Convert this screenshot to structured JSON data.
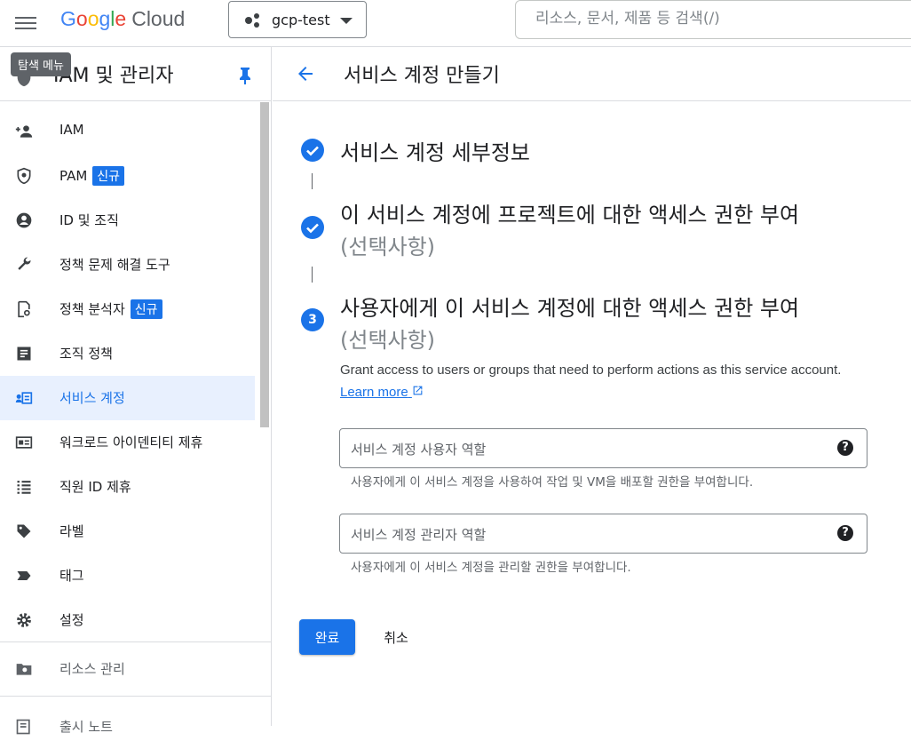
{
  "header": {
    "logo_google": [
      "G",
      "o",
      "o",
      "g",
      "l",
      "e"
    ],
    "logo_cloud": "Cloud",
    "project_name": "gcp-test",
    "search_placeholder": "리소스, 문서, 제품 등 검색(/)"
  },
  "sidebar": {
    "tooltip": "탐색 메뉴",
    "title": "IAM 및 관리자",
    "items": [
      {
        "label": "IAM",
        "icon": "person-add-icon"
      },
      {
        "label": "PAM",
        "icon": "shield-icon",
        "badge": "신규"
      },
      {
        "label": "ID 및 조직",
        "icon": "account-circle-icon"
      },
      {
        "label": "정책 문제 해결 도구",
        "icon": "wrench-icon"
      },
      {
        "label": "정책 분석자",
        "icon": "policy-search-icon",
        "badge": "신규"
      },
      {
        "label": "조직 정책",
        "icon": "document-icon"
      },
      {
        "label": "서비스 계정",
        "icon": "service-account-icon",
        "active": true
      },
      {
        "label": "워크로드 아이덴티티 제휴",
        "icon": "id-card-icon"
      },
      {
        "label": "직원 ID 제휴",
        "icon": "list-icon"
      },
      {
        "label": "라벨",
        "icon": "label-icon"
      },
      {
        "label": "태그",
        "icon": "tag-icon"
      },
      {
        "label": "설정",
        "icon": "gear-icon"
      }
    ],
    "resource_manage": "리소스 관리",
    "release_notes": "출시 노트"
  },
  "main": {
    "title": "서비스 계정 만들기",
    "steps": [
      {
        "title": "서비스 계정 세부정보",
        "state": "done"
      },
      {
        "title": "이 서비스 계정에 프로젝트에 대한 액세스 권한 부여",
        "subtitle": "(선택사항)",
        "state": "done"
      },
      {
        "number": "3",
        "title": "사용자에게 이 서비스 계정에 대한 액세스 권한 부여",
        "subtitle": "(선택사항)",
        "state": "current"
      }
    ],
    "grant_desc": "Grant access to users or groups that need to perform actions as this service account.",
    "learn_more": "Learn more",
    "fields": [
      {
        "placeholder": "서비스 계정 사용자 역할",
        "hint": "사용자에게 이 서비스 계정을 사용하여 작업 및 VM을 배포할 권한을 부여합니다."
      },
      {
        "placeholder": "서비스 계정 관리자 역할",
        "hint": "사용자에게 이 서비스 계정을 관리할 권한을 부여합니다."
      }
    ],
    "help_glyph": "?",
    "done_label": "완료",
    "cancel_label": "취소"
  },
  "colors": {
    "accent": "#1a73e8",
    "active_bg": "#e8f0fe"
  }
}
